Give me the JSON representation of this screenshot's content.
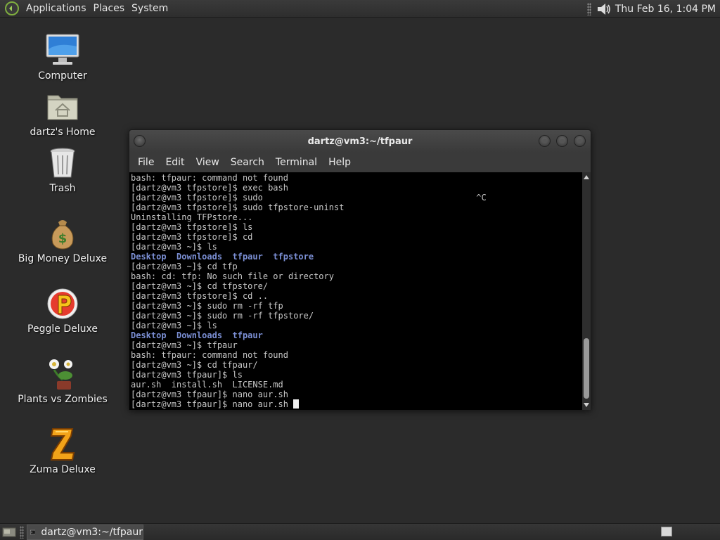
{
  "top_panel": {
    "menus": [
      "Applications",
      "Places",
      "System"
    ],
    "clock": "Thu Feb 16,  1:04 PM"
  },
  "desktop_icons": [
    {
      "label": "Computer",
      "icon": "computer-icon"
    },
    {
      "label": "dartz's Home",
      "icon": "home-folder-icon"
    },
    {
      "label": "Trash",
      "icon": "trash-icon"
    },
    {
      "label": "Big Money Deluxe",
      "icon": "money-bag-icon"
    },
    {
      "label": "Peggle Deluxe",
      "icon": "peggle-icon"
    },
    {
      "label": "Plants vs Zombies",
      "icon": "plants-icon"
    },
    {
      "label": "Zuma Deluxe",
      "icon": "zuma-icon"
    }
  ],
  "window": {
    "title": "dartz@vm3:~/tfpaur",
    "menu": [
      "File",
      "Edit",
      "View",
      "Search",
      "Terminal",
      "Help"
    ]
  },
  "terminal": {
    "lines": [
      {
        "text": "bash: tfpaur: command not found"
      },
      {
        "text": "[dartz@vm3 tfpstore]$ exec bash"
      },
      {
        "text": "[dartz@vm3 tfpstore]$ sudo                                          ^C"
      },
      {
        "text": "[dartz@vm3 tfpstore]$ sudo tfpstore-uninst"
      },
      {
        "text": "Uninstalling TFPstore..."
      },
      {
        "text": "[dartz@vm3 tfpstore]$ ls"
      },
      {
        "text": "[dartz@vm3 tfpstore]$ cd"
      },
      {
        "text": "[dartz@vm3 ~]$ ls"
      },
      {
        "dirs": "Desktop  Downloads  tfpaur  tfpstore"
      },
      {
        "text": "[dartz@vm3 ~]$ cd tfp"
      },
      {
        "text": "bash: cd: tfp: No such file or directory"
      },
      {
        "text": "[dartz@vm3 ~]$ cd tfpstore/"
      },
      {
        "text": "[dartz@vm3 tfpstore]$ cd .."
      },
      {
        "text": "[dartz@vm3 ~]$ sudo rm -rf tfp"
      },
      {
        "text": "[dartz@vm3 ~]$ sudo rm -rf tfpstore/"
      },
      {
        "text": "[dartz@vm3 ~]$ ls"
      },
      {
        "dirs": "Desktop  Downloads  tfpaur"
      },
      {
        "text": "[dartz@vm3 ~]$ tfpaur"
      },
      {
        "text": "bash: tfpaur: command not found"
      },
      {
        "text": "[dartz@vm3 ~]$ cd tfpaur/"
      },
      {
        "text": "[dartz@vm3 tfpaur]$ ls"
      },
      {
        "text": "aur.sh  install.sh  LICENSE.md"
      },
      {
        "text": "[dartz@vm3 tfpaur]$ nano aur.sh"
      },
      {
        "text": "[dartz@vm3 tfpaur]$ nano aur.sh ",
        "cursor": true
      }
    ]
  },
  "taskbar": {
    "task_label": "dartz@vm3:~/tfpaur"
  },
  "colors": {
    "desktop_bg": "#2b2b2b",
    "terminal_bg": "#000000",
    "terminal_fg": "#c8c8c8",
    "dir_color": "#7b8fd4"
  }
}
